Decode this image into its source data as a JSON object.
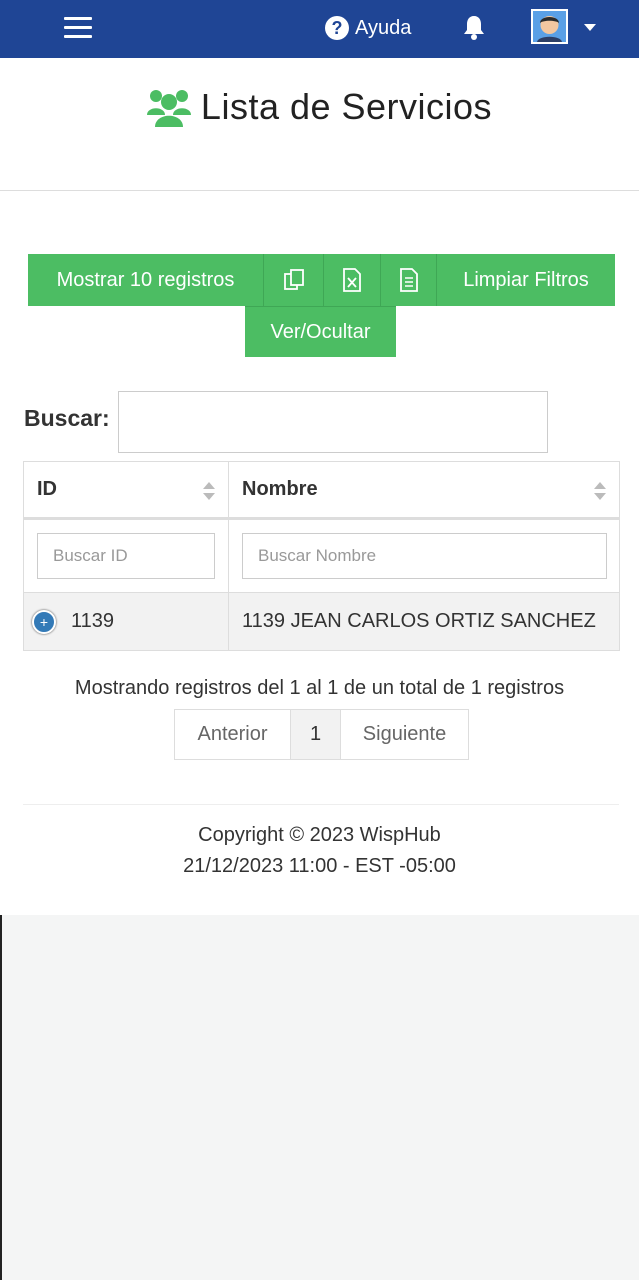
{
  "header": {
    "help_label": "Ayuda",
    "brand_color": "#1f4595"
  },
  "page": {
    "title": "Lista de Servicios"
  },
  "toolbar": {
    "show_records_label": "Mostrar 10 registros",
    "copy_icon": "copy-icon",
    "excel_icon": "excel-icon",
    "csv_icon": "csv-file-icon",
    "clear_filters_label": "Limpiar Filtros",
    "toggle_columns_label": "Ver/Ocultar",
    "accent_color": "#4cbd63"
  },
  "search": {
    "label": "Buscar:",
    "value": ""
  },
  "table": {
    "columns": [
      "ID",
      "Nombre"
    ],
    "filters": {
      "id_placeholder": "Buscar ID",
      "name_placeholder": "Buscar Nombre"
    },
    "rows": [
      {
        "id": "1139",
        "name": "1139 JEAN CARLOS ORTIZ SANCHEZ"
      }
    ]
  },
  "pagination": {
    "info": "Mostrando registros del 1 al 1 de un total de 1 registros",
    "prev_label": "Anterior",
    "current_page": "1",
    "next_label": "Siguiente"
  },
  "footer": {
    "copyright": "Copyright © 2023 WispHub",
    "datetime": "21/12/2023 11:00 - EST -05:00"
  }
}
